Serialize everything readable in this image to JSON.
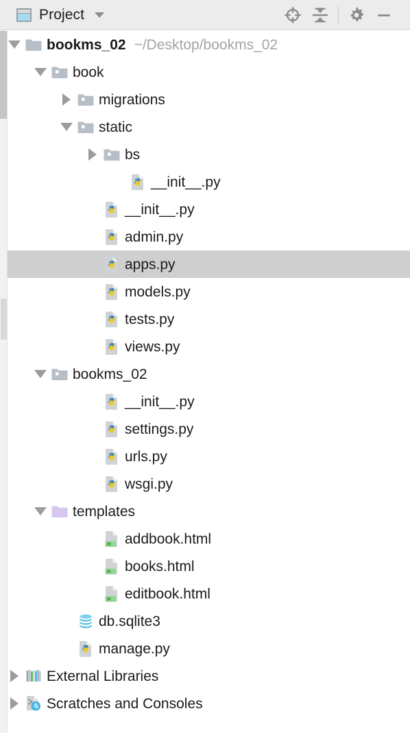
{
  "toolbar": {
    "title": "Project",
    "window_icon": "project-window-icon",
    "dropdown_icon": "chevron-down-icon",
    "buttons": [
      {
        "name": "select-opened-file-icon",
        "label": "Select Opened File"
      },
      {
        "name": "collapse-all-icon",
        "label": "Collapse All"
      },
      {
        "name": "gear-icon",
        "label": "Settings"
      },
      {
        "name": "minimize-icon",
        "label": "Hide"
      }
    ]
  },
  "tree": {
    "rows": [
      {
        "depth": 0,
        "twisty": "down",
        "icon": "folder",
        "label": "bookms_02",
        "bold": true,
        "path": "~/Desktop/bookms_02",
        "selected": false
      },
      {
        "depth": 1,
        "twisty": "down",
        "icon": "folder-module",
        "label": "book",
        "bold": false,
        "path": "",
        "selected": false
      },
      {
        "depth": 2,
        "twisty": "right",
        "icon": "folder-module",
        "label": "migrations",
        "bold": false,
        "path": "",
        "selected": false
      },
      {
        "depth": 2,
        "twisty": "down",
        "icon": "folder-module",
        "label": "static",
        "bold": false,
        "path": "",
        "selected": false
      },
      {
        "depth": 3,
        "twisty": "right",
        "icon": "folder-module",
        "label": "bs",
        "bold": false,
        "path": "",
        "selected": false
      },
      {
        "depth": 4,
        "twisty": "none",
        "icon": "python",
        "label": "__init__.py",
        "bold": false,
        "path": "",
        "selected": false
      },
      {
        "depth": 3,
        "twisty": "none",
        "icon": "python",
        "label": "__init__.py",
        "bold": false,
        "path": "",
        "selected": false
      },
      {
        "depth": 3,
        "twisty": "none",
        "icon": "python",
        "label": "admin.py",
        "bold": false,
        "path": "",
        "selected": false
      },
      {
        "depth": 3,
        "twisty": "none",
        "icon": "python",
        "label": "apps.py",
        "bold": false,
        "path": "",
        "selected": true
      },
      {
        "depth": 3,
        "twisty": "none",
        "icon": "python",
        "label": "models.py",
        "bold": false,
        "path": "",
        "selected": false
      },
      {
        "depth": 3,
        "twisty": "none",
        "icon": "python",
        "label": "tests.py",
        "bold": false,
        "path": "",
        "selected": false
      },
      {
        "depth": 3,
        "twisty": "none",
        "icon": "python",
        "label": "views.py",
        "bold": false,
        "path": "",
        "selected": false
      },
      {
        "depth": 1,
        "twisty": "down",
        "icon": "folder-module",
        "label": "bookms_02",
        "bold": false,
        "path": "",
        "selected": false
      },
      {
        "depth": 3,
        "twisty": "none",
        "icon": "python",
        "label": "__init__.py",
        "bold": false,
        "path": "",
        "selected": false
      },
      {
        "depth": 3,
        "twisty": "none",
        "icon": "python",
        "label": "settings.py",
        "bold": false,
        "path": "",
        "selected": false
      },
      {
        "depth": 3,
        "twisty": "none",
        "icon": "python",
        "label": "urls.py",
        "bold": false,
        "path": "",
        "selected": false
      },
      {
        "depth": 3,
        "twisty": "none",
        "icon": "python",
        "label": "wsgi.py",
        "bold": false,
        "path": "",
        "selected": false
      },
      {
        "depth": 1,
        "twisty": "down",
        "icon": "folder-plain",
        "label": "templates",
        "bold": false,
        "path": "",
        "selected": false
      },
      {
        "depth": 3,
        "twisty": "none",
        "icon": "html",
        "label": "addbook.html",
        "bold": false,
        "path": "",
        "selected": false
      },
      {
        "depth": 3,
        "twisty": "none",
        "icon": "html",
        "label": "books.html",
        "bold": false,
        "path": "",
        "selected": false
      },
      {
        "depth": 3,
        "twisty": "none",
        "icon": "html",
        "label": "editbook.html",
        "bold": false,
        "path": "",
        "selected": false
      },
      {
        "depth": 2,
        "twisty": "none",
        "icon": "database",
        "label": "db.sqlite3",
        "bold": false,
        "path": "",
        "selected": false
      },
      {
        "depth": 2,
        "twisty": "none",
        "icon": "python",
        "label": "manage.py",
        "bold": false,
        "path": "",
        "selected": false
      },
      {
        "depth": 0,
        "twisty": "right",
        "icon": "libraries",
        "label": "External Libraries",
        "bold": false,
        "path": "",
        "selected": false
      },
      {
        "depth": 0,
        "twisty": "right",
        "icon": "scratches",
        "label": "Scratches and Consoles",
        "bold": false,
        "path": "",
        "selected": false
      }
    ]
  },
  "colors": {
    "toolbar_bg": "#ececec",
    "selection_bg": "#cfcfcf",
    "folder_gray": "#a9b7c6",
    "folder_purple": "#d6c6f0",
    "python_blue": "#3a7fb8",
    "python_yellow": "#f2cb1d",
    "html_green": "#8fd88f",
    "database_cyan": "#56c0e0",
    "text": "#1a1a1a",
    "path_text": "#a4a4a4"
  }
}
